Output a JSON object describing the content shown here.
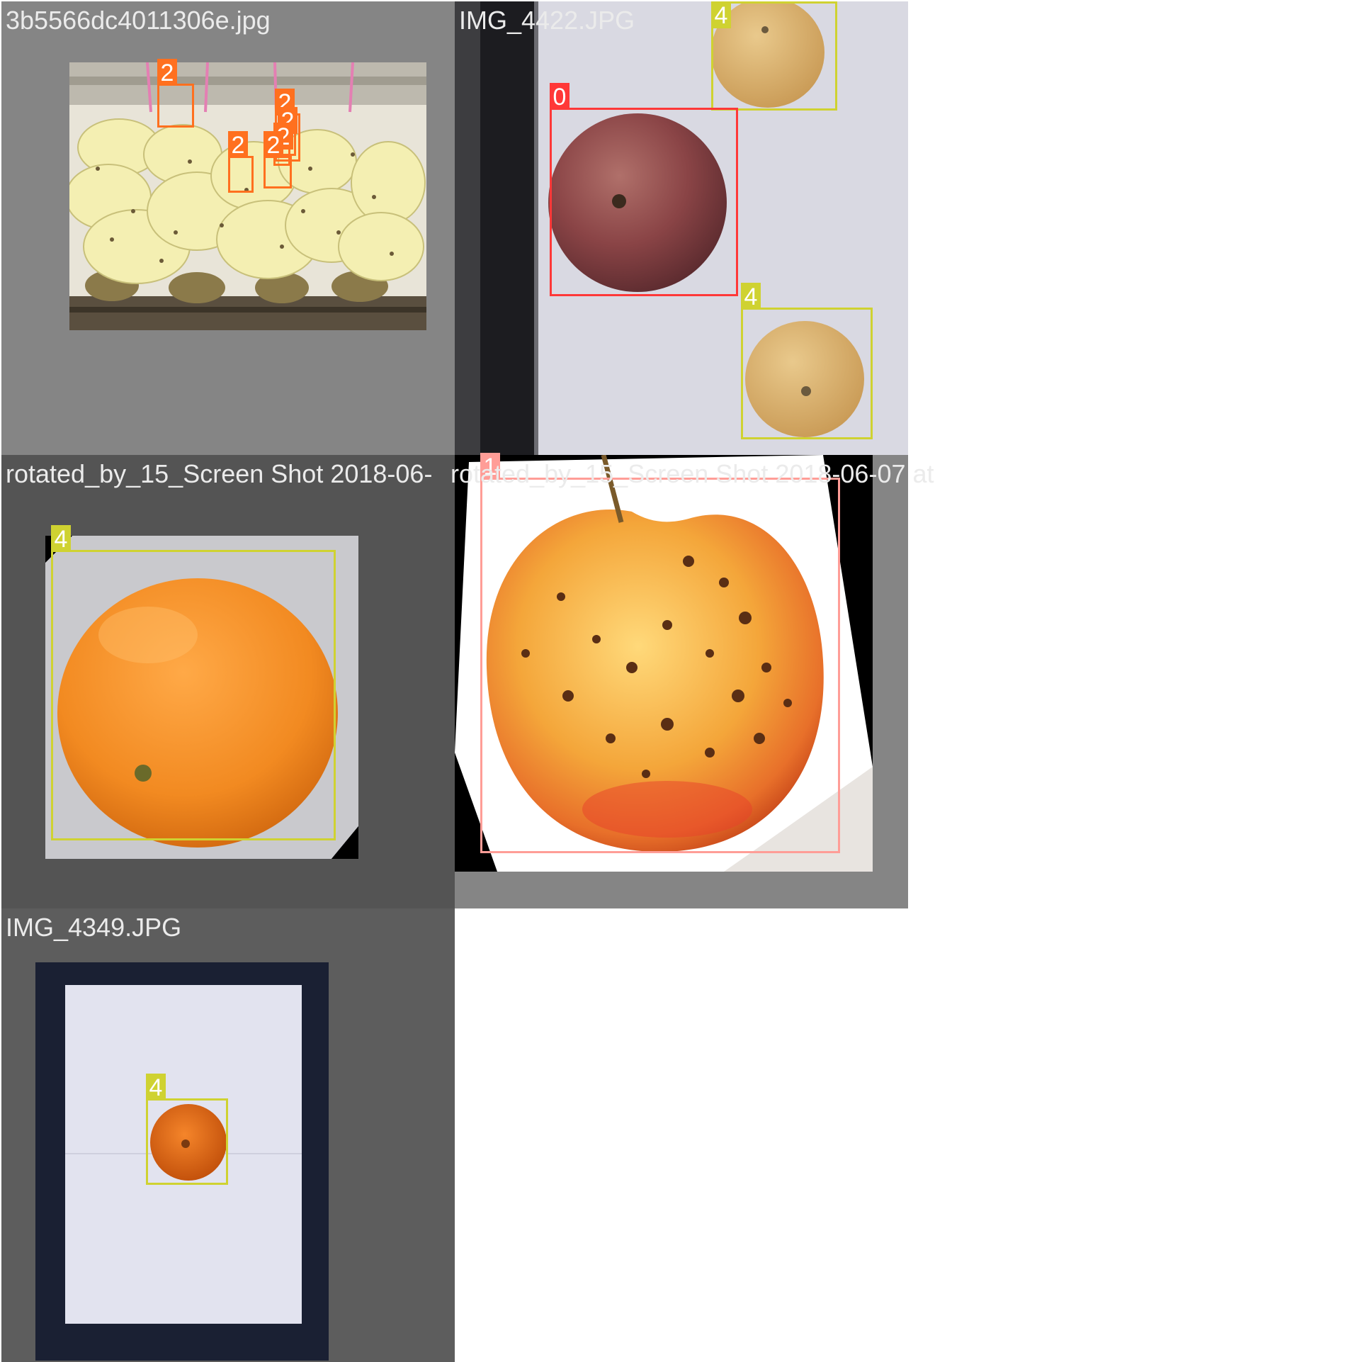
{
  "palette": {
    "class_0": "#ff3838",
    "class_1": "#ff9d97",
    "class_2": "#ff701f",
    "class_4": "#cfd231"
  },
  "tiles": [
    {
      "filename": "3b5566dc4011306e.jpg",
      "subject": "bananas-and-pineapples",
      "boxes": [
        {
          "label": "2",
          "class": "banana"
        },
        {
          "label": "2",
          "class": "banana"
        },
        {
          "label": "2",
          "class": "banana"
        },
        {
          "label": "2",
          "class": "banana"
        },
        {
          "label": "2",
          "class": "banana"
        },
        {
          "label": "2",
          "class": "banana"
        }
      ]
    },
    {
      "filename": "IMG_4422.JPG",
      "subject": "apple-and-two-oranges",
      "boxes": [
        {
          "label": "4",
          "class": "orange"
        },
        {
          "label": "0",
          "class": "apple"
        },
        {
          "label": "4",
          "class": "orange"
        }
      ]
    },
    {
      "filename": "rotated_by_15_Screen Shot 2018-06-",
      "subject": "rotated-orange",
      "boxes": [
        {
          "label": "4",
          "class": "orange"
        }
      ]
    },
    {
      "filename": "rotated_by_15_Screen Shot 2018-06-07 at",
      "subject": "rotated-spotted-apple",
      "boxes": [
        {
          "label": "1",
          "class": "apple"
        }
      ]
    },
    {
      "filename": "IMG_4349.JPG",
      "subject": "orange-on-paper",
      "boxes": [
        {
          "label": "4",
          "class": "orange"
        }
      ]
    }
  ]
}
